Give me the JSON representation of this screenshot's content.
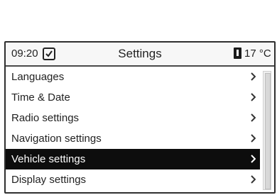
{
  "status": {
    "time": "09:20",
    "title": "Settings",
    "temperature": "17 °C"
  },
  "menu": {
    "items": [
      {
        "label": "Languages",
        "selected": false
      },
      {
        "label": "Time & Date",
        "selected": false
      },
      {
        "label": "Radio settings",
        "selected": false
      },
      {
        "label": "Navigation settings",
        "selected": false
      },
      {
        "label": "Vehicle settings",
        "selected": true
      },
      {
        "label": "Display settings",
        "selected": false
      }
    ]
  },
  "icons": {
    "clock": "clock-icon",
    "thermometer": "thermometer-icon",
    "chevron": "chevron-right-icon"
  },
  "colors": {
    "selected_bg": "#0d0d0d",
    "selected_text": "#ffffff"
  }
}
